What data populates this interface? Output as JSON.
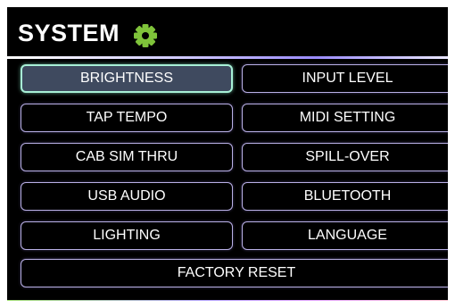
{
  "header": {
    "title": "SYSTEM",
    "icon": "gear-icon",
    "icon_color": "#7fc33a"
  },
  "menu": {
    "brightness": "BRIGHTNESS",
    "input_level": "INPUT LEVEL",
    "tap_tempo": "TAP TEMPO",
    "midi_setting": "MIDI SETTING",
    "cab_sim_thru": "CAB SIM THRU",
    "spill_over": "SPILL-OVER",
    "usb_audio": "USB AUDIO",
    "bluetooth": "BLUETOOTH",
    "lighting": "LIGHTING",
    "language": "LANGUAGE",
    "factory_reset": "FACTORY RESET",
    "selected": "BRIGHTNESS"
  },
  "colors": {
    "background": "#000000",
    "selected_fill": "#3f4a5f",
    "selected_border": "#a8f0d6",
    "border": "#b9b0e6"
  }
}
